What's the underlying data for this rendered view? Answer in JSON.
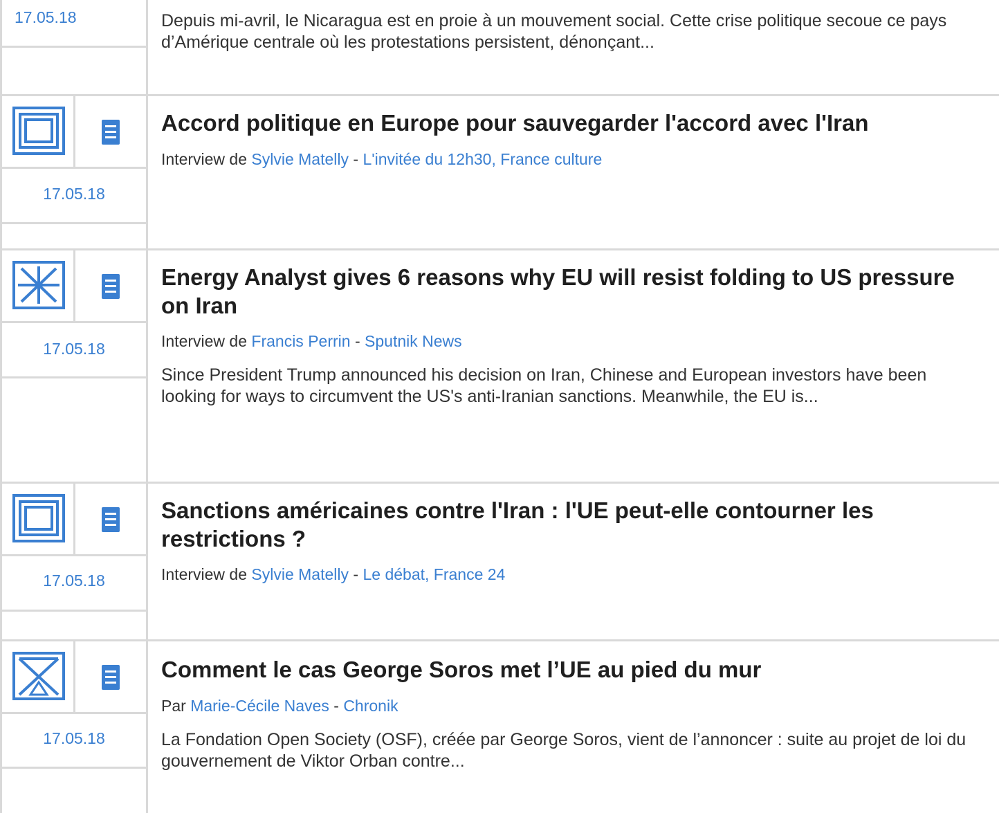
{
  "items": [
    {
      "date": "17.05.18",
      "summary": "Depuis mi-avril, le Nicaragua est en proie à un mouvement social. Cette crise politique secoue ce pays d’Amérique centrale où les protestations persistent, dénonçant..."
    },
    {
      "icon": "nested-squares-icon",
      "date": "17.05.18",
      "title": "Accord politique en Europe pour sauvegarder l'accord avec l'Iran",
      "prefix": "Interview de",
      "author": "Sylvie Matelly",
      "sep": "-",
      "source": "L'invitée du 12h30, France culture"
    },
    {
      "icon": "asterisk-icon",
      "date": "17.05.18",
      "title": "Energy Analyst gives 6 reasons why EU will resist folding to US pressure on Iran",
      "prefix": "Interview de",
      "author": "Francis Perrin",
      "sep": "-",
      "source": "Sputnik News",
      "summary": "Since President Trump announced his decision on Iran, Chinese and European investors have been looking for ways to circumvent the US's anti-Iranian sanctions. Meanwhile, the EU is..."
    },
    {
      "icon": "nested-squares-icon",
      "date": "17.05.18",
      "title": "Sanctions américaines contre l'Iran : l'UE peut-elle contourner les restrictions ?",
      "prefix": "Interview de",
      "author": "Sylvie Matelly",
      "sep": "-",
      "source": "Le débat, France 24"
    },
    {
      "icon": "hourglass-icon",
      "date": "17.05.18",
      "title": "Comment le cas George Soros met l’UE au pied du mur",
      "prefix": "Par",
      "author": "Marie-Cécile Naves",
      "sep": "-",
      "source": "Chronik",
      "summary": "La Fondation Open Society (OSF), créée par George Soros, vient de l’annoncer : suite au projet de loi du gouvernement de Viktor Orban contre..."
    }
  ],
  "colors": {
    "accent": "#3a7fd1",
    "border": "#d9d9d9",
    "title": "#1f1f1f"
  }
}
